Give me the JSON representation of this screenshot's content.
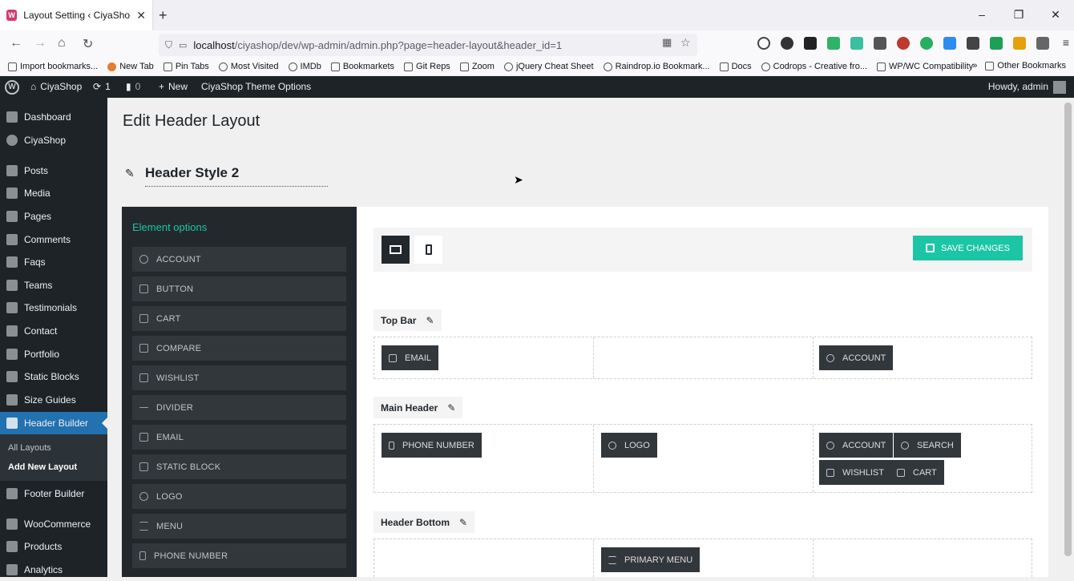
{
  "browser": {
    "tab_title": "Layout Setting ‹ CiyaShop — W",
    "url_host": "localhost",
    "url_path": "/ciyashop/dev/wp-admin/admin.php?page=header-layout&header_id=1",
    "bookmarks": [
      "Import bookmarks...",
      "New Tab",
      "Pin Tabs",
      "Most Visited",
      "IMDb",
      "Bookmarkets",
      "Git Reps",
      "Zoom",
      "jQuery Cheat Sheet",
      "Raindrop.io Bookmark...",
      "Docs",
      "Codrops - Creative fro...",
      "WP/WC Compatibility"
    ],
    "other_bookmarks": "Other Bookmarks"
  },
  "adminbar": {
    "site": "CiyaShop",
    "updates": "1",
    "comments": "0",
    "new": "New",
    "theme_options": "CiyaShop Theme Options",
    "howdy": "Howdy, admin"
  },
  "sidebar": {
    "items": [
      "Dashboard",
      "CiyaShop",
      "Posts",
      "Media",
      "Pages",
      "Comments",
      "Faqs",
      "Teams",
      "Testimonials",
      "Contact",
      "Portfolio",
      "Static Blocks",
      "Size Guides",
      "Header Builder",
      "Footer Builder",
      "WooCommerce",
      "Products",
      "Analytics"
    ],
    "submenu": [
      "All Layouts",
      "Add New Layout"
    ]
  },
  "page": {
    "title": "Edit Header Layout",
    "header_style": "Header Style 2"
  },
  "elements": {
    "title": "Element options",
    "items": [
      "ACCOUNT",
      "BUTTON",
      "CART",
      "COMPARE",
      "WISHLIST",
      "DIVIDER",
      "EMAIL",
      "STATIC BLOCK",
      "LOGO",
      "MENU",
      "PHONE NUMBER"
    ]
  },
  "builder": {
    "save_label": "SAVE CHANGES",
    "sections": {
      "top_bar": {
        "label": "Top Bar",
        "left": [
          "EMAIL"
        ],
        "right": [
          "ACCOUNT"
        ]
      },
      "main_header": {
        "label": "Main Header",
        "left": [
          "PHONE NUMBER"
        ],
        "center": [
          "LOGO"
        ],
        "right": [
          "ACCOUNT",
          "SEARCH",
          "WISHLIST",
          "CART"
        ]
      },
      "header_bottom": {
        "label": "Header Bottom",
        "center": [
          "PRIMARY MENU"
        ]
      }
    }
  },
  "colors": {
    "accent": "#1cc5a5",
    "admin_dark": "#1d2327",
    "active_menu": "#2271b1"
  }
}
